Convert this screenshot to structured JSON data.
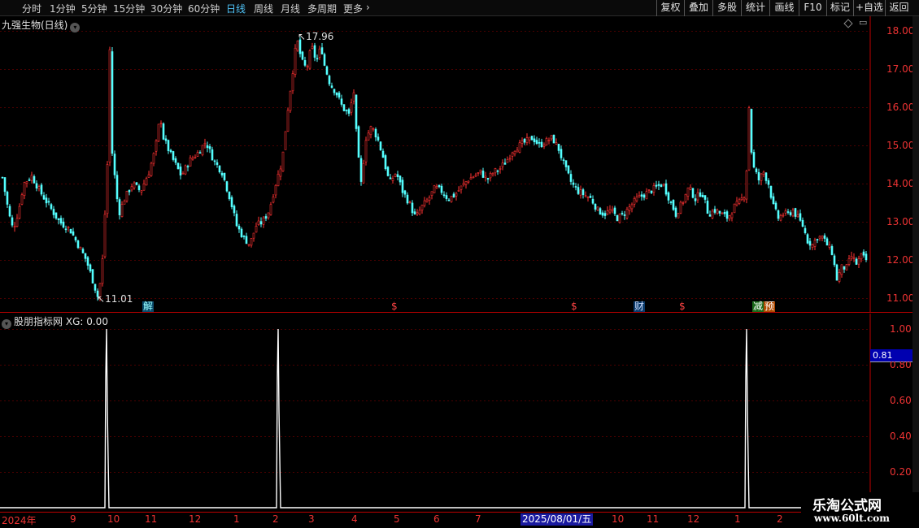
{
  "toolbar": {
    "periods": [
      "分时",
      "1分钟",
      "5分钟",
      "15分钟",
      "30分钟",
      "60分钟",
      "日线",
      "周线",
      "月线",
      "多周期",
      "更多"
    ],
    "more_arrow": "›",
    "buttons": [
      "复权",
      "叠加",
      "多股",
      "统计",
      "画线",
      "F10",
      "标记",
      "+自选",
      "返回"
    ]
  },
  "main_chart": {
    "title": "九强生物(日线)",
    "high_label": "17.96",
    "low_label": "11.01",
    "event_labels": [
      "解",
      "$",
      "$",
      "财",
      "$",
      "减",
      "预"
    ],
    "colors": {
      "up": "#ff3232",
      "down": "#54ffff",
      "grid": "#4a0000",
      "axis": "#c00000"
    }
  },
  "indicator": {
    "title": "股朋指标网",
    "series_name": "XG",
    "value": "0.00",
    "cursor_value": "0.81"
  },
  "date_axis": {
    "cursor_date": "2025/08/01/五"
  },
  "watermark": {
    "title": "乐淘公式网",
    "url": "www.60lt.com"
  },
  "chart_data": [
    {
      "type": "candlestick",
      "title": "九强生物(日线)",
      "y_ticks": [
        "18.00",
        "17.00",
        "16.00",
        "15.00",
        "14.00",
        "13.00",
        "12.00",
        "11.00"
      ],
      "ylim": [
        10.85,
        18.25
      ],
      "x_ticks": [
        "2024年",
        "9",
        "10",
        "11",
        "12",
        "1",
        "2",
        "3",
        "4",
        "5",
        "6",
        "7",
        "10",
        "11",
        "12",
        "1",
        "2"
      ],
      "close_path": [
        [
          0,
          14.4
        ],
        [
          10,
          13.2
        ],
        [
          15,
          12.8
        ],
        [
          22,
          13.3
        ],
        [
          28,
          14.0
        ],
        [
          38,
          14.2
        ],
        [
          48,
          13.8
        ],
        [
          60,
          13.4
        ],
        [
          72,
          13.0
        ],
        [
          85,
          12.8
        ],
        [
          95,
          12.4
        ],
        [
          105,
          12.0
        ],
        [
          114,
          11.4
        ],
        [
          119,
          11.05
        ],
        [
          124,
          11.6
        ],
        [
          128,
          13.2
        ],
        [
          131,
          14.5
        ],
        [
          134,
          17.5
        ],
        [
          137,
          14.8
        ],
        [
          145,
          13.2
        ],
        [
          152,
          13.6
        ],
        [
          162,
          14.0
        ],
        [
          172,
          13.8
        ],
        [
          182,
          14.3
        ],
        [
          190,
          14.9
        ],
        [
          196,
          15.8
        ],
        [
          200,
          15.2
        ],
        [
          210,
          14.7
        ],
        [
          222,
          14.2
        ],
        [
          232,
          14.6
        ],
        [
          242,
          14.8
        ],
        [
          252,
          15.1
        ],
        [
          262,
          14.6
        ],
        [
          272,
          14.3
        ],
        [
          282,
          13.6
        ],
        [
          290,
          12.9
        ],
        [
          298,
          12.6
        ],
        [
          306,
          12.4
        ],
        [
          314,
          12.9
        ],
        [
          322,
          13.0
        ],
        [
          330,
          13.3
        ],
        [
          338,
          14.0
        ],
        [
          346,
          14.6
        ],
        [
          352,
          15.8
        ],
        [
          358,
          16.8
        ],
        [
          364,
          17.8
        ],
        [
          370,
          17.2
        ],
        [
          376,
          17.0
        ],
        [
          382,
          17.6
        ],
        [
          388,
          17.2
        ],
        [
          394,
          17.6
        ],
        [
          398,
          17.1
        ],
        [
          405,
          16.6
        ],
        [
          412,
          16.4
        ],
        [
          420,
          16.0
        ],
        [
          428,
          15.8
        ],
        [
          434,
          16.4
        ],
        [
          438,
          15.0
        ],
        [
          443,
          14.0
        ],
        [
          449,
          15.2
        ],
        [
          456,
          15.5
        ],
        [
          463,
          15.2
        ],
        [
          470,
          14.7
        ],
        [
          478,
          14.0
        ],
        [
          486,
          14.3
        ],
        [
          494,
          13.8
        ],
        [
          502,
          13.5
        ],
        [
          510,
          13.1
        ],
        [
          518,
          13.4
        ],
        [
          526,
          13.6
        ],
        [
          534,
          13.9
        ],
        [
          542,
          13.8
        ],
        [
          550,
          13.6
        ],
        [
          558,
          13.7
        ],
        [
          566,
          13.9
        ],
        [
          574,
          14.1
        ],
        [
          582,
          14.2
        ],
        [
          590,
          14.3
        ],
        [
          598,
          14.1
        ],
        [
          606,
          14.3
        ],
        [
          614,
          14.4
        ],
        [
          622,
          14.6
        ],
        [
          630,
          14.9
        ],
        [
          638,
          15.0
        ],
        [
          646,
          15.1
        ],
        [
          654,
          15.2
        ],
        [
          662,
          15.0
        ],
        [
          670,
          15.1
        ],
        [
          678,
          15.2
        ],
        [
          686,
          14.9
        ],
        [
          694,
          14.4
        ],
        [
          702,
          14.0
        ],
        [
          710,
          13.8
        ],
        [
          718,
          13.7
        ],
        [
          726,
          13.6
        ],
        [
          734,
          13.3
        ],
        [
          742,
          13.2
        ],
        [
          750,
          13.3
        ],
        [
          758,
          13.1
        ],
        [
          766,
          13.2
        ],
        [
          774,
          13.4
        ],
        [
          782,
          13.6
        ],
        [
          790,
          13.7
        ],
        [
          798,
          13.8
        ],
        [
          806,
          13.9
        ],
        [
          814,
          14.0
        ],
        [
          822,
          13.6
        ],
        [
          830,
          13.2
        ],
        [
          838,
          13.5
        ],
        [
          846,
          13.9
        ],
        [
          854,
          13.6
        ],
        [
          862,
          13.8
        ],
        [
          870,
          13.2
        ],
        [
          878,
          13.3
        ],
        [
          886,
          13.2
        ],
        [
          894,
          13.1
        ],
        [
          902,
          13.4
        ],
        [
          908,
          13.5
        ],
        [
          914,
          13.7
        ],
        [
          918,
          14.6
        ],
        [
          920,
          16.0
        ],
        [
          922,
          15.0
        ],
        [
          926,
          14.4
        ],
        [
          932,
          14.1
        ],
        [
          938,
          14.3
        ],
        [
          944,
          14.0
        ],
        [
          950,
          13.4
        ],
        [
          956,
          13.1
        ],
        [
          962,
          13.2
        ],
        [
          968,
          13.2
        ],
        [
          974,
          13.3
        ],
        [
          980,
          13.1
        ],
        [
          986,
          12.9
        ],
        [
          992,
          12.5
        ],
        [
          998,
          12.4
        ],
        [
          1004,
          12.6
        ],
        [
          1010,
          12.6
        ],
        [
          1016,
          12.4
        ],
        [
          1022,
          12.2
        ],
        [
          1028,
          11.5
        ],
        [
          1034,
          11.8
        ],
        [
          1040,
          11.8
        ],
        [
          1046,
          12.1
        ],
        [
          1052,
          11.9
        ],
        [
          1058,
          12.1
        ],
        [
          1064,
          12.0
        ]
      ]
    },
    {
      "type": "line",
      "title": "股朋指标网",
      "series": [
        {
          "name": "XG",
          "spikes": [
            "2024-10",
            "2025-02",
            "2026-01"
          ],
          "spike_value": 1.0,
          "base_value": 0.0
        }
      ],
      "y_ticks": [
        "1.00",
        "0.80",
        "0.60",
        "0.40",
        "0.20"
      ],
      "ylim": [
        0,
        1.0
      ]
    }
  ]
}
